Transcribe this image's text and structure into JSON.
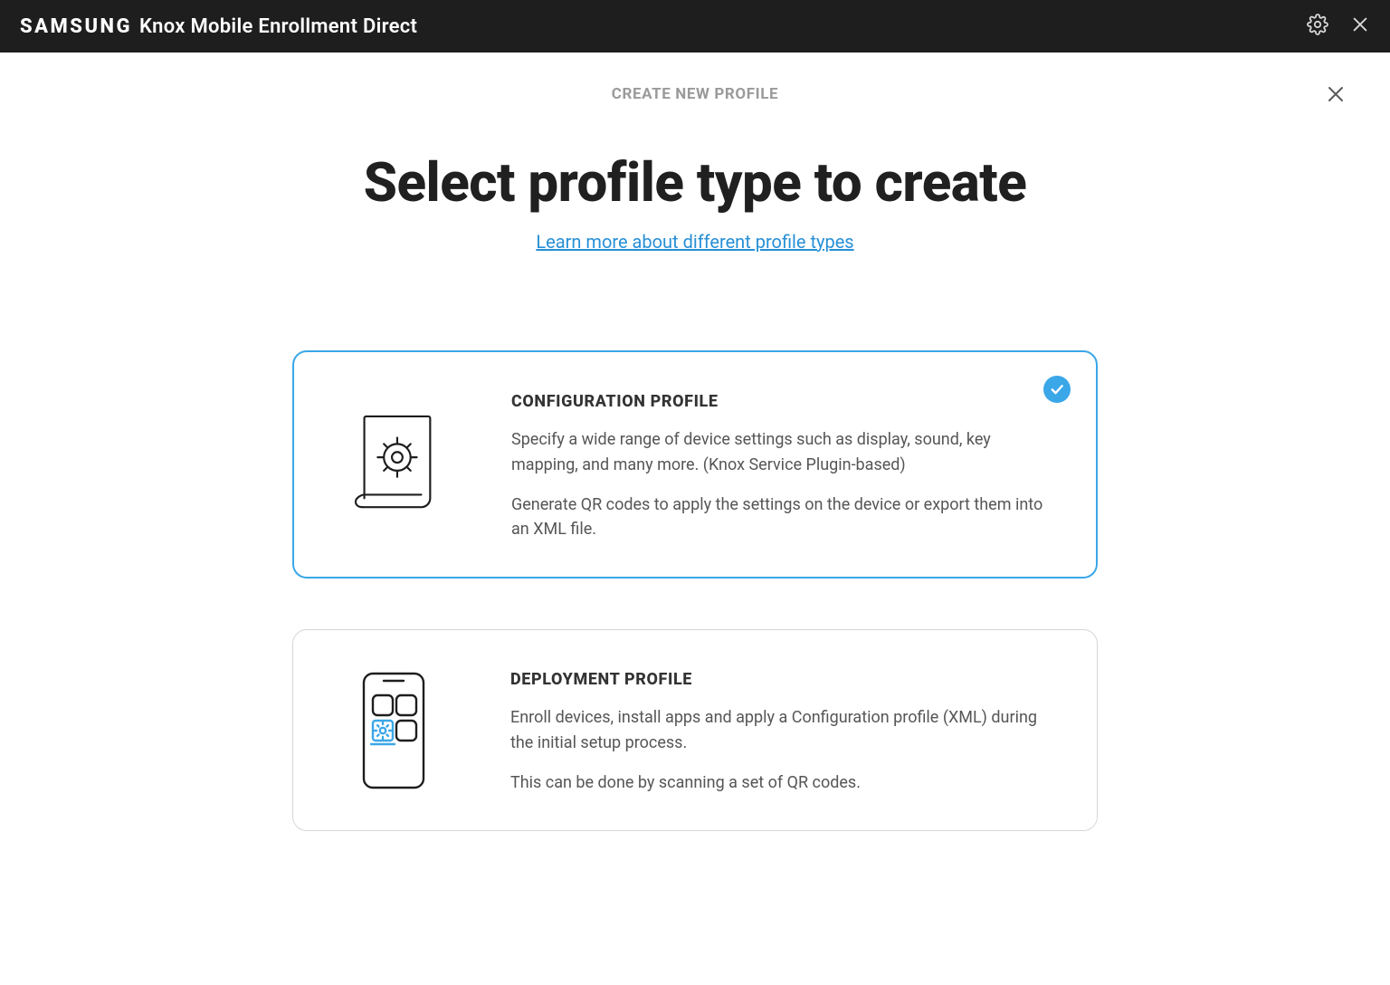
{
  "header": {
    "brand_main": "SAMSUNG",
    "brand_product": "Knox Mobile Enrollment Direct"
  },
  "page": {
    "overline": "CREATE NEW PROFILE",
    "title": "Select profile type to create",
    "learn_more": "Learn more about different profile types"
  },
  "cards": [
    {
      "id": "configuration",
      "title": "CONFIGURATION PROFILE",
      "desc1": "Specify a wide range of device settings such as display, sound, key mapping, and many more. (Knox Service Plugin-based)",
      "desc2": "Generate QR codes to apply the settings on the device or export them into an XML file.",
      "selected": true
    },
    {
      "id": "deployment",
      "title": "DEPLOYMENT PROFILE",
      "desc1": "Enroll devices, install apps and apply a Configuration profile (XML) during the initial setup process.",
      "desc2": "This can be done by scanning a set of QR codes.",
      "selected": false
    }
  ],
  "colors": {
    "accent": "#3aa7e8"
  }
}
